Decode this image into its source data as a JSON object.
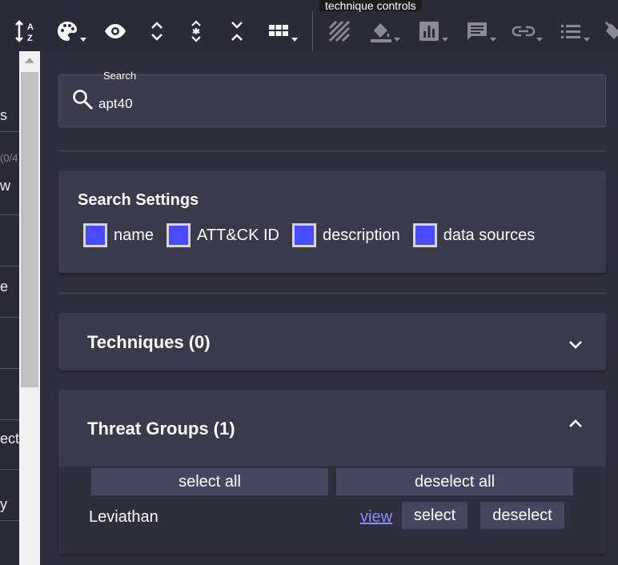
{
  "toolbar": {
    "tooltip": "technique controls",
    "icons": [
      "sort-az-icon",
      "palette-icon",
      "eye-icon",
      "expand-icon",
      "expand-all-icon",
      "collapse-icon",
      "grid-icon",
      "stripes-icon",
      "fill-bucket-icon",
      "bar-chart-icon",
      "comment-icon",
      "link-icon",
      "list-icon",
      "clear-icon"
    ]
  },
  "left_strip": {
    "fragments": [
      "s",
      "(0/4",
      "w",
      "e",
      "ect",
      "y"
    ]
  },
  "search": {
    "label": "Search",
    "value": "apt40",
    "icon": "search-icon"
  },
  "search_settings": {
    "title": "Search Settings",
    "options": [
      {
        "label": "name",
        "checked": true
      },
      {
        "label": "ATT&CK ID",
        "checked": true
      },
      {
        "label": "description",
        "checked": true
      },
      {
        "label": "data sources",
        "checked": true
      }
    ]
  },
  "techniques_panel": {
    "title": "Techniques (0)",
    "expanded": false
  },
  "threat_groups_panel": {
    "title": "Threat Groups (1)",
    "expanded": true,
    "select_all_label": "select all",
    "deselect_all_label": "deselect all",
    "groups": [
      {
        "name": "Leviathan",
        "view_label": "view",
        "select_label": "select",
        "deselect_label": "deselect"
      }
    ]
  },
  "colors": {
    "background": "#2f2e3d",
    "card": "#3b3a4c",
    "checkbox_fill": "#4a4aff",
    "link": "#8a8cff",
    "button": "#474660"
  }
}
